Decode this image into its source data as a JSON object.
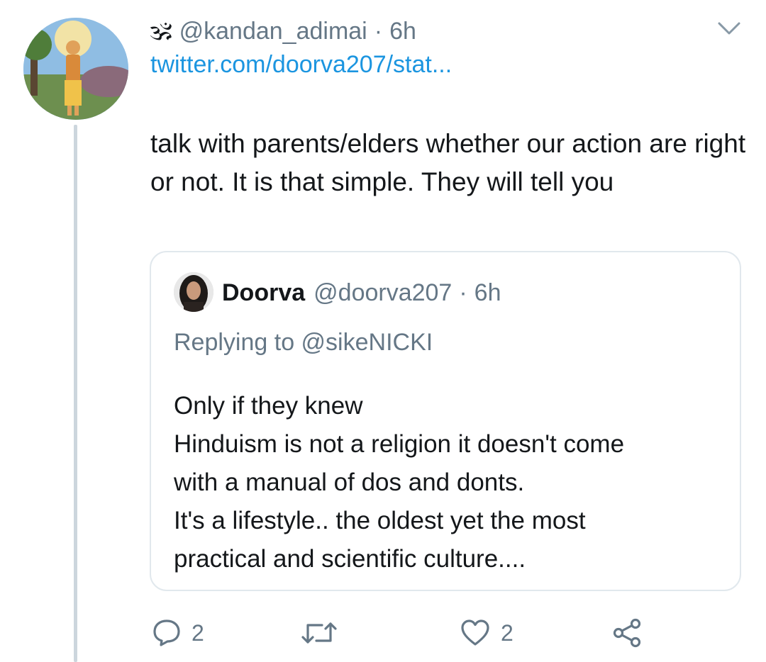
{
  "tweet": {
    "author_emoji": "🕉",
    "author_handle": "@kandan_adimai",
    "separator": "·",
    "time": "6h",
    "link": "twitter.com/doorva207/stat...",
    "text": "talk with parents/elders whether our action are right or not. It is that simple. They will tell you"
  },
  "quote": {
    "name": "Doorva",
    "handle": "@doorva207",
    "separator": "·",
    "time": "6h",
    "replying_to": "Replying to @sikeNICKI",
    "lines": [
      "Only if they knew",
      "Hinduism is not a religion it doesn't come",
      "with a manual of dos and donts.",
      "It's a lifestyle.. the oldest yet the most",
      "practical and scientific culture...."
    ]
  },
  "actions": {
    "reply_count": "2",
    "retweet_count": "",
    "like_count": "2"
  },
  "icons": {
    "menu": "chevron-down-icon",
    "reply": "reply-icon",
    "retweet": "retweet-icon",
    "like": "heart-icon",
    "share": "share-icon"
  },
  "colors": {
    "link": "#1b95e0",
    "secondary_text": "#657786",
    "border": "#e1e8ed",
    "thread_line": "#ccd6dd"
  }
}
